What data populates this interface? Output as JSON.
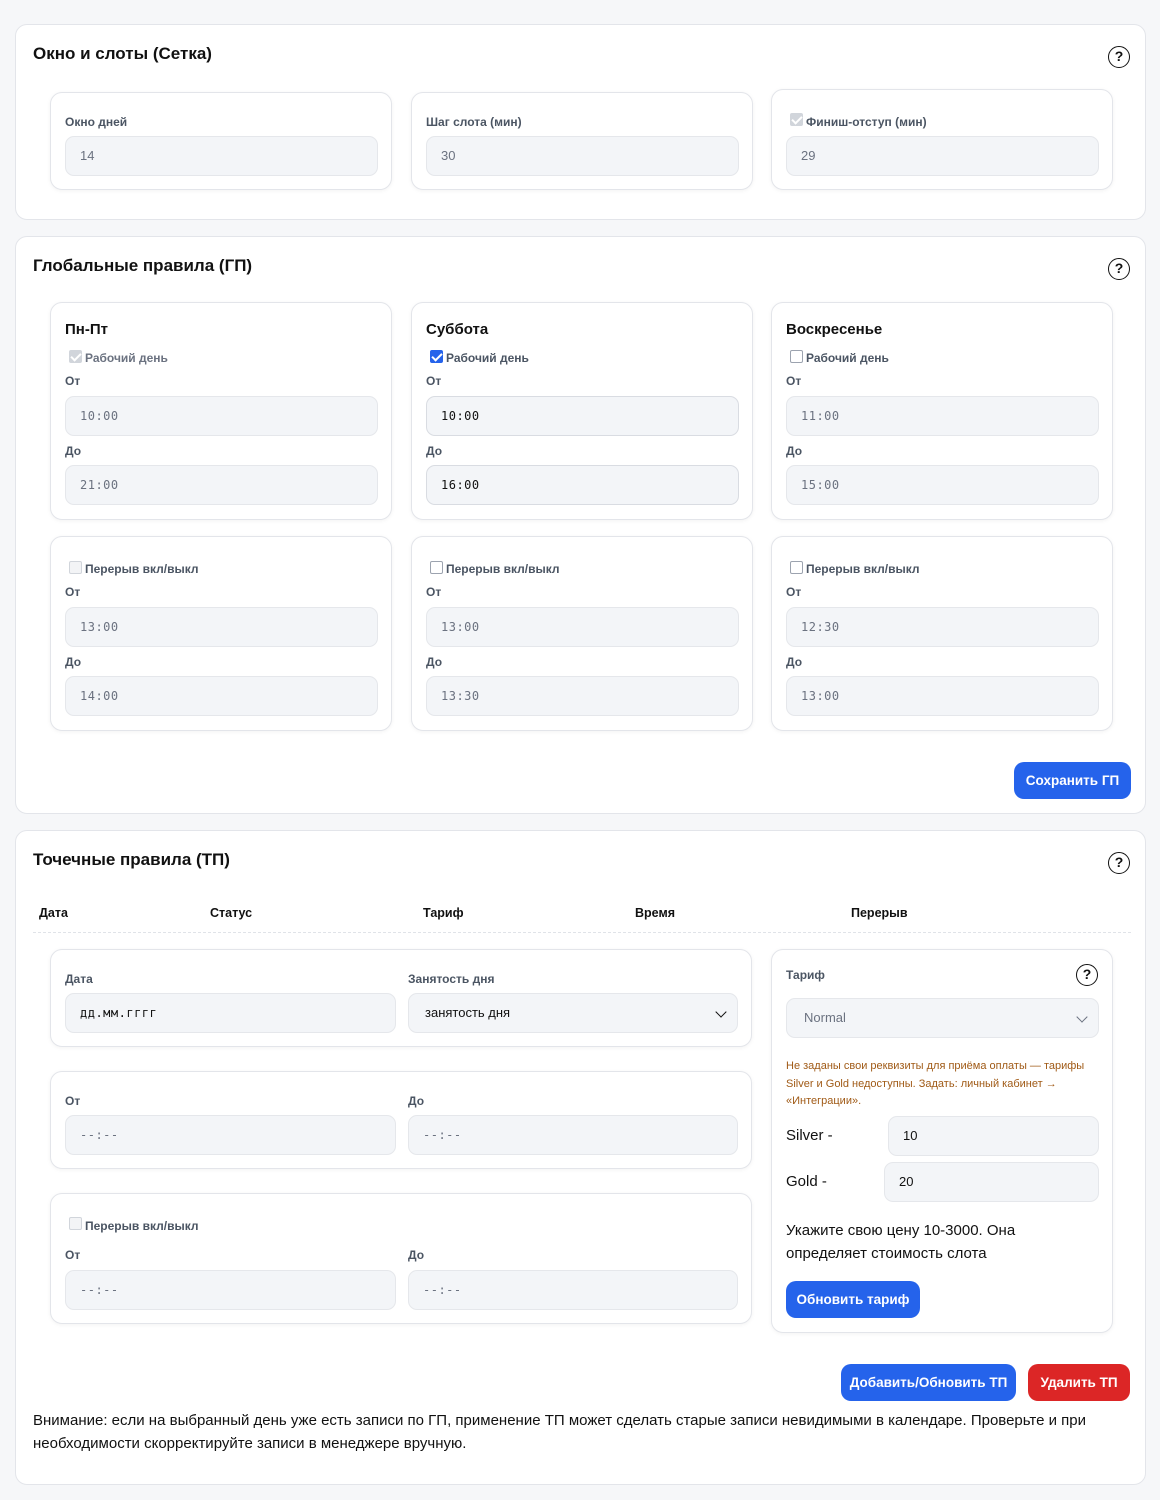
{
  "grid": {
    "title": "Окно и слоты (Сетка)",
    "window_days": {
      "label": "Окно дней",
      "value": "14"
    },
    "slot_step": {
      "label": "Шаг слота (мин)",
      "value": "30"
    },
    "finish_offset": {
      "label": "Финиш-отступ (мин)",
      "value": "29"
    }
  },
  "global_rules": {
    "title": "Глобальные правила (ГП)",
    "days": [
      {
        "title": "Пн-Пт",
        "workday_label": "Рабочий день",
        "from_label": "От",
        "from": "10:00",
        "to_label": "До",
        "to": "21:00"
      },
      {
        "title": "Суббота",
        "workday_label": "Рабочий день",
        "from_label": "От",
        "from": "10:00",
        "to_label": "До",
        "to": "16:00"
      },
      {
        "title": "Воскресенье",
        "workday_label": "Рабочий день",
        "from_label": "От",
        "from": "11:00",
        "to_label": "До",
        "to": "15:00"
      }
    ],
    "breaks": [
      {
        "toggle_label": "Перерыв вкл/выкл",
        "from_label": "От",
        "from": "13:00",
        "to_label": "До",
        "to": "14:00"
      },
      {
        "toggle_label": "Перерыв вкл/выкл",
        "from_label": "От",
        "from": "13:00",
        "to_label": "До",
        "to": "13:30"
      },
      {
        "toggle_label": "Перерыв вкл/выкл",
        "from_label": "От",
        "from": "12:30",
        "to_label": "До",
        "to": "13:00"
      }
    ],
    "save_button": "Сохранить ГП"
  },
  "point_rules": {
    "title": "Точечные правила (ТП)",
    "table_headers": [
      "Дата",
      "Статус",
      "Тариф",
      "Время",
      "Перерыв"
    ],
    "date_label": "Дата",
    "date_placeholder": "дд.мм.гггг",
    "occupancy_label": "Занятость дня",
    "occupancy_value": "занятость дня",
    "from_label": "От",
    "to_label": "До",
    "time_placeholder": "--:--",
    "break_toggle_label": "Перерыв вкл/выкл",
    "break_from_label": "От",
    "break_to_label": "До",
    "tariff": {
      "label": "Тариф",
      "selected": "Normal",
      "warning": "Не заданы свои реквизиты для приёма оплаты — тарифы Silver и Gold недоступны. Задать: личный кабинет → «Интеграции».",
      "silver_label": "Silver -",
      "silver_value": "10",
      "gold_label": "Gold -",
      "gold_value": "20",
      "hint": "Укажите свою цену 10-3000. Она определяет стоимость слота",
      "update_button": "Обновить тариф"
    },
    "add_button": "Добавить/Обновить ТП",
    "delete_button": "Удалить ТП",
    "notice": "Внимание: если на выбранный день уже есть записи по ГП, применение ТП может сделать старые записи невидимыми в календаре. Проверьте и при необходимости скорректируйте записи в менеджере вручную."
  }
}
